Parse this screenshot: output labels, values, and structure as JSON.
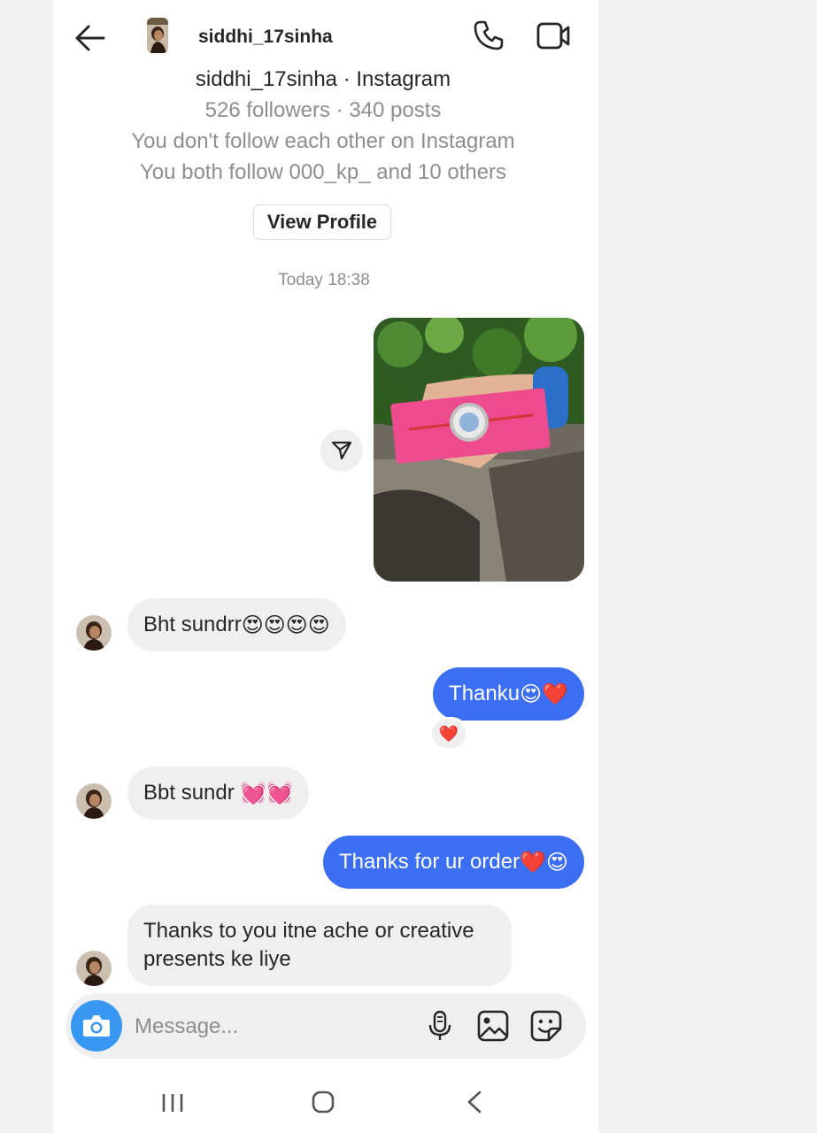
{
  "header": {
    "username": "siddhi_17sinha",
    "icons": [
      "back-arrow-icon",
      "avatar",
      "phone-icon",
      "video-camera-icon"
    ]
  },
  "profile": {
    "title": "siddhi_17sinha · Instagram",
    "stats": "526 followers · 340 posts",
    "follow_status": "You don't follow each other on Instagram",
    "mutual": "You both follow 000_kp_ and 10 others",
    "view_profile_label": "View Profile"
  },
  "conversation": {
    "timestamp": "Today 18:38",
    "messages": [
      {
        "from": "them",
        "text": "Bht sundrr",
        "emoji": "😍😍😍😍"
      },
      {
        "from": "me",
        "text": "Thanku",
        "emoji": "😍❤️",
        "reaction": "❤️"
      },
      {
        "from": "them",
        "text": "Bbt sundr ",
        "emoji": "💓💓"
      },
      {
        "from": "me",
        "text": "Thanks for ur order",
        "emoji": "❤️😍"
      },
      {
        "from": "them",
        "text_line1": "Thanks to you itne ache or creative",
        "text_line2": "presents ke liye"
      }
    ]
  },
  "composer": {
    "placeholder": "Message...",
    "icons": [
      "camera-icon",
      "microphone-icon",
      "gallery-icon",
      "sticker-icon"
    ]
  },
  "colors": {
    "outgoing_bubble": "#3b6ef2",
    "incoming_bubble": "#efefef",
    "camera_button": "#3897f0",
    "secondary_text": "#8e8e8e"
  }
}
